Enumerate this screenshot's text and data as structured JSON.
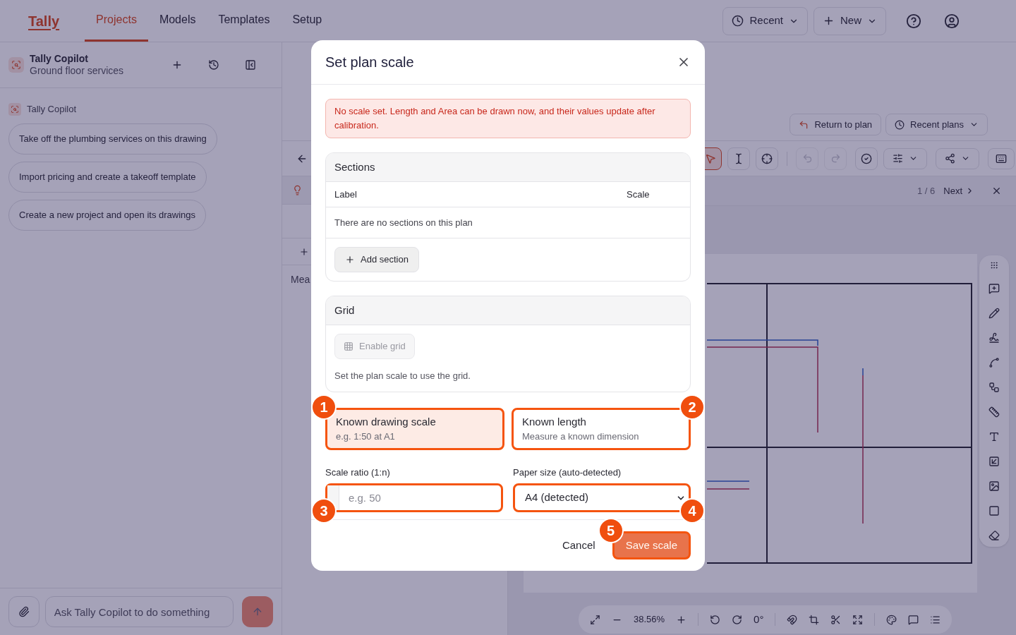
{
  "nav": {
    "logo": "Tally",
    "links": [
      {
        "label": "Projects",
        "selected": true
      },
      {
        "label": "Models",
        "selected": false
      },
      {
        "label": "Templates",
        "selected": false
      },
      {
        "label": "Setup",
        "selected": false
      }
    ],
    "actions": [
      {
        "label": "Recent"
      },
      {
        "label": "New"
      }
    ]
  },
  "copilot": {
    "title": "Tally Copilot",
    "subtitle": "Ground floor services",
    "sender": "Tally Copilot",
    "suggestions": [
      "Take off the plumbing services on this drawing",
      "Import pricing and create a takeoff template",
      "Create a new project and open its drawings"
    ],
    "input": {
      "placeholder": "Ask Tally Copilot to do something"
    }
  },
  "middle_panel": {
    "partial_label": "Mea"
  },
  "viewer": {
    "header_buttons": [
      "Return to plan",
      "Recent plans"
    ],
    "tools": [
      {
        "selected": true
      },
      {
        "selected": false
      },
      {
        "selected": false
      }
    ],
    "history": [
      {
        "disabled": true
      },
      {
        "disabled": true
      }
    ],
    "pager": {
      "count": "1 / 6",
      "next": "Next"
    },
    "zoom_bar": {
      "zoom": "38.56%",
      "rotation": "0°"
    }
  },
  "dialog": {
    "title": "Set plan scale",
    "alert": "No scale set. Length and Area can be drawn now, and their values update after calibration.",
    "sections": {
      "heading": "Sections",
      "columns": [
        "Label",
        "Scale"
      ],
      "empty": "There are no sections on this plan",
      "add_button": "Add section"
    },
    "grid": {
      "heading": "Grid",
      "button": {
        "label": "Enable grid",
        "disabled": true
      },
      "hint": "Set the plan scale to use the grid."
    },
    "methods": [
      {
        "title": "Known drawing scale",
        "subtitle": "e.g. 1:50 at A1",
        "selected": true,
        "callout": "1"
      },
      {
        "title": "Known length",
        "subtitle": "Measure a known dimension",
        "selected": false,
        "callout": "2"
      }
    ],
    "scale_ratio": {
      "label": "Scale ratio (1:n)",
      "placeholder": "e.g. 50",
      "callout": "3"
    },
    "paper_size": {
      "label": "Paper size (auto-detected)",
      "value": "A4 (detected)",
      "callout": "4"
    },
    "cancel": "Cancel",
    "save": {
      "label": "Save scale",
      "disabled": true,
      "callout": "5"
    }
  }
}
